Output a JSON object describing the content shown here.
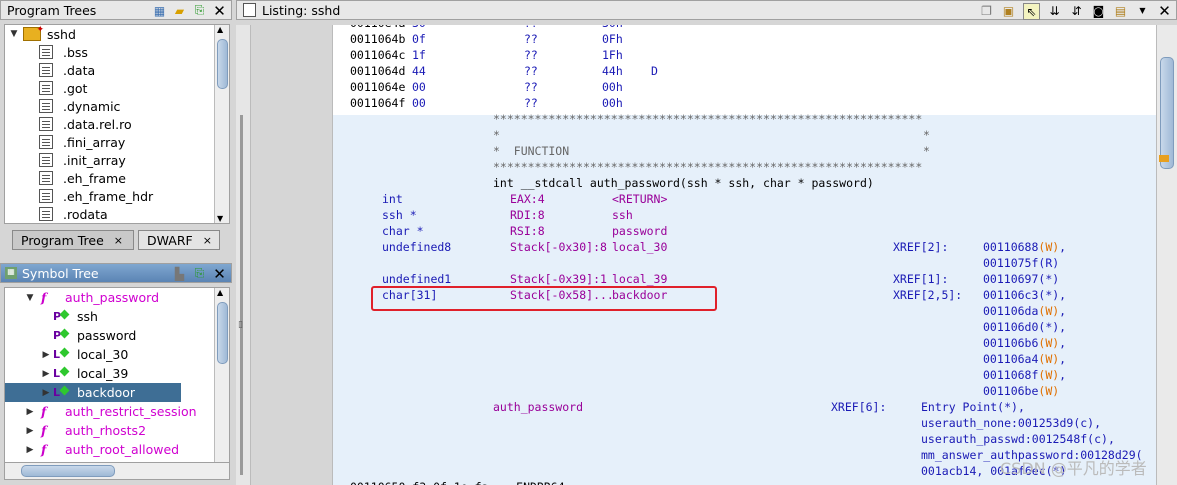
{
  "program_trees": {
    "title": "Program Trees",
    "root": "sshd",
    "items": [
      ".bss",
      ".data",
      ".got",
      ".dynamic",
      ".data.rel.ro",
      ".fini_array",
      ".init_array",
      ".eh_frame",
      ".eh_frame_hdr",
      ".rodata"
    ],
    "tabs": [
      {
        "label": "Program Tree"
      },
      {
        "label": "DWARF"
      }
    ]
  },
  "symbol_tree": {
    "title": "Symbol Tree",
    "function": "auth_password",
    "children": [
      {
        "label": "ssh",
        "kind": "param"
      },
      {
        "label": "password",
        "kind": "param"
      },
      {
        "label": "local_30",
        "kind": "local"
      },
      {
        "label": "local_39",
        "kind": "local"
      },
      {
        "label": "backdoor",
        "kind": "local"
      }
    ],
    "other_functions": [
      "auth_restrict_session",
      "auth_rhosts2",
      "auth_root_allowed"
    ]
  },
  "listing": {
    "title": "Listing:  sshd",
    "data_rows": [
      {
        "addr": "0011064b",
        "byte": "0f",
        "mn": "??",
        "val": "0Fh",
        "ch": ""
      },
      {
        "addr": "0011064c",
        "byte": "1f",
        "mn": "??",
        "val": "1Fh",
        "ch": ""
      },
      {
        "addr": "0011064d",
        "byte": "44",
        "mn": "??",
        "val": "44h",
        "ch": "D"
      },
      {
        "addr": "0011064e",
        "byte": "00",
        "mn": "??",
        "val": "00h",
        "ch": ""
      },
      {
        "addr": "0011064f",
        "byte": "00",
        "mn": "??",
        "val": "00h",
        "ch": ""
      }
    ],
    "stars": "**************************************************************",
    "star_side": "*",
    "function_label": "*  FUNCTION",
    "signature": "int __stdcall auth_password(ssh * ssh, char * password)",
    "vars": [
      {
        "type": "int",
        "storage": "EAX:4",
        "name": "<RETURN>"
      },
      {
        "type": "ssh *",
        "storage": "RDI:8",
        "name": "ssh"
      },
      {
        "type": "char *",
        "storage": "RSI:8",
        "name": "password"
      },
      {
        "type": "undefined8",
        "storage": "Stack[-0x30]:8",
        "name": "local_30"
      },
      {
        "type": "undefined1",
        "storage": "Stack[-0x39]:1",
        "name": "local_39"
      },
      {
        "type": "char[31]",
        "storage": "Stack[-0x58]...",
        "name": "backdoor"
      }
    ],
    "xref_local30": {
      "label": "XREF[2]:",
      "refs": [
        "00110688(W),",
        "0011075f(R)"
      ]
    },
    "xref_local39": {
      "label": "XREF[1]:",
      "refs": [
        "00110697(*)"
      ]
    },
    "xref_backdoor": {
      "label": "XREF[2,5]:",
      "refs": [
        "001106c3(*),",
        "001106da(W),",
        "001106d0(*),",
        "001106b6(W),",
        "001106a4(W),",
        "0011068f(W),",
        "001106be(W)"
      ]
    },
    "func_name": "auth_password",
    "func_xref": {
      "label": "XREF[6]:",
      "refs": [
        "Entry Point(*),",
        "userauth_none:001253d9(c),",
        "userauth_passwd:0012548f(c),",
        "mm_answer_authpassword:00128d29(",
        "001acb14, 001af6ec(*)"
      ]
    },
    "bottom_partial": "00110650 f3 0f 1e fa    ENDBR64"
  },
  "watermark": "CSDN @平凡的学者"
}
